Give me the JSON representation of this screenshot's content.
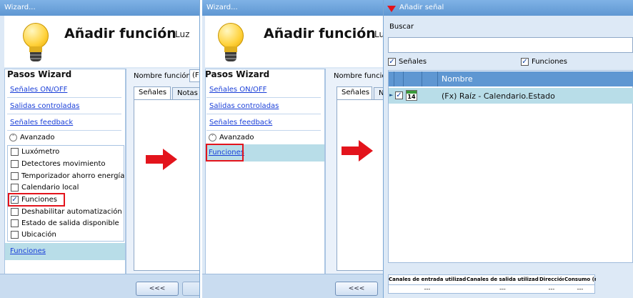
{
  "colors": {
    "accent": "#5f97d2",
    "highlight": "#b8dde8",
    "annotation": "#e3141c",
    "link": "#1a3fd8"
  },
  "panel1": {
    "window_title": "Wizard...",
    "header_title": "Añadir función",
    "header_subtitle": "Luz",
    "steps_title": "Pasos Wizard",
    "steps": [
      "Señales ON/OFF",
      "Salidas controladas",
      "Señales feedback"
    ],
    "advanced_label": "Avanzado",
    "options": [
      {
        "label": "Luxómetro",
        "checked": false
      },
      {
        "label": "Detectores movimiento",
        "checked": false
      },
      {
        "label": "Temporizador ahorro energía",
        "checked": false
      },
      {
        "label": "Calendario local",
        "checked": false
      },
      {
        "label": "Funciones",
        "checked": true
      },
      {
        "label": "Deshabilitar automatización",
        "checked": false
      },
      {
        "label": "Estado de salida disponible",
        "checked": false
      },
      {
        "label": "Ubicación",
        "checked": false
      }
    ],
    "added_step": "Funciones",
    "function_name_label": "Nombre función:",
    "function_name_value": "(Fx",
    "tabs": [
      "Señales",
      "Notas"
    ],
    "back_button": "<<<"
  },
  "panel2": {
    "window_title": "Wizard...",
    "header_title": "Añadir función",
    "header_subtitle": "Lu",
    "steps_title": "Pasos Wizard",
    "steps": [
      "Señales ON/OFF",
      "Salidas controladas",
      "Señales feedback"
    ],
    "advanced_label": "Avanzado",
    "added_step": "Funciones",
    "function_name_label": "Nombre función",
    "tabs": [
      "Señales",
      "N"
    ],
    "back_button": "<<<"
  },
  "panel3": {
    "window_title": "Añadir señal",
    "search_label": "Buscar",
    "search_value": "",
    "filter_signals": "Señales",
    "filter_functions": "Funciones",
    "column_name": "Nombre",
    "row_icon": "calendar-icon",
    "row_icon_text": "14",
    "row_name": "(Fx) Raíz - Calendario.Estado",
    "summary_headers": [
      "Canales de entrada utilizados",
      "Canales de salida utilizados",
      "Dirección",
      "Consumo (mA)"
    ],
    "summary_values": [
      "---",
      "---",
      "---",
      "---"
    ]
  }
}
